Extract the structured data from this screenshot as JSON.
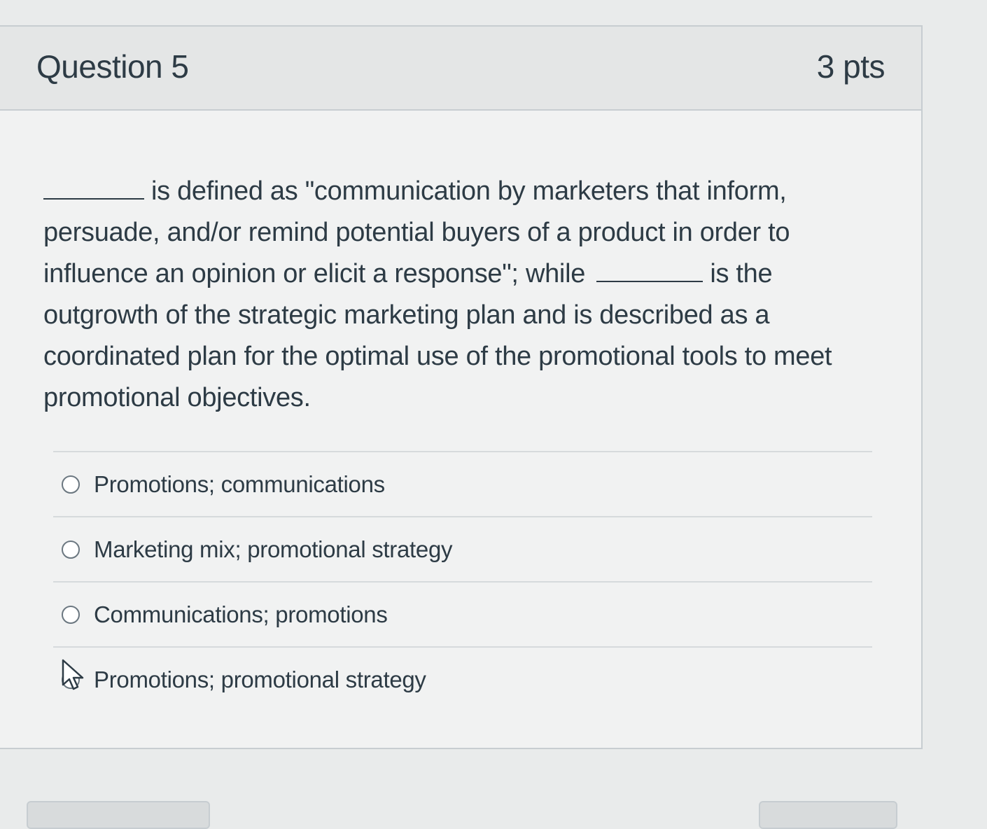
{
  "question": {
    "title": "Question 5",
    "points": "3 pts",
    "text_part1": "is defined as \"communication by marketers that inform, persuade, and/or remind potential buyers of a product in order to influence an opinion or elicit a response\"; while",
    "text_part2": "is the outgrowth of the strategic marketing plan and is described as a coordinated plan for the optimal use of the promotional tools to meet promotional objectives."
  },
  "answers": [
    {
      "label": "Promotions; communications"
    },
    {
      "label": "Marketing mix; promotional strategy"
    },
    {
      "label": "Communications; promotions"
    },
    {
      "label": "Promotions; promotional strategy"
    }
  ],
  "icons": {
    "radio": "radio-circle",
    "cursor": "mouse-pointer"
  },
  "colors": {
    "text": "#2d3b45",
    "border": "#c7cdd1",
    "header_bg": "#e4e6e6"
  }
}
